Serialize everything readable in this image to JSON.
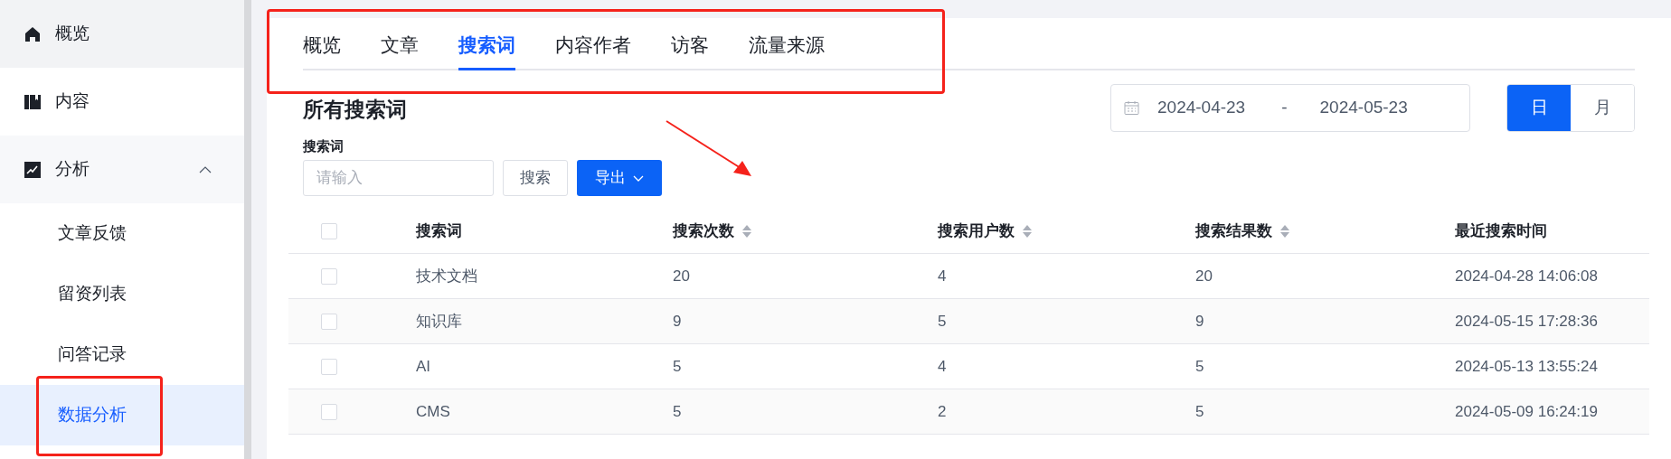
{
  "sidebar": {
    "items": [
      {
        "label": "概览",
        "selected": false
      },
      {
        "label": "内容",
        "selected": false
      },
      {
        "label": "分析",
        "selected": false,
        "expanded": true,
        "children": [
          {
            "label": "文章反馈",
            "selected": false
          },
          {
            "label": "留资列表",
            "selected": false
          },
          {
            "label": "问答记录",
            "selected": false
          },
          {
            "label": "数据分析",
            "selected": true
          }
        ]
      }
    ]
  },
  "tabs": [
    {
      "label": "概览",
      "selected": false
    },
    {
      "label": "文章",
      "selected": false
    },
    {
      "label": "搜索词",
      "selected": true
    },
    {
      "label": "内容作者",
      "selected": false
    },
    {
      "label": "访客",
      "selected": false
    },
    {
      "label": "流量来源",
      "selected": false
    }
  ],
  "title": "所有搜索词",
  "date_range": {
    "start": "2024-04-23",
    "separator": "-",
    "end": "2024-05-23"
  },
  "granularity": [
    {
      "label": "日",
      "selected": true
    },
    {
      "label": "月",
      "selected": false
    }
  ],
  "filter": {
    "label": "搜索词",
    "placeholder": "请输入",
    "search_button": "搜索",
    "export_button": "导出"
  },
  "table": {
    "select_all_checked": false,
    "columns": [
      {
        "label": "搜索词",
        "sortable": false
      },
      {
        "label": "搜索次数",
        "sortable": true
      },
      {
        "label": "搜索用户数",
        "sortable": true
      },
      {
        "label": "搜索结果数",
        "sortable": true
      },
      {
        "label": "最近搜索时间",
        "sortable": false
      }
    ],
    "rows": [
      {
        "checked": false,
        "cells": [
          "技术文档",
          "20",
          "4",
          "20",
          "2024-04-28 14:06:08"
        ]
      },
      {
        "checked": false,
        "cells": [
          "知识库",
          "9",
          "5",
          "9",
          "2024-05-15 17:28:36"
        ]
      },
      {
        "checked": false,
        "cells": [
          "AI",
          "5",
          "4",
          "5",
          "2024-05-13 13:55:24"
        ]
      },
      {
        "checked": false,
        "cells": [
          "CMS",
          "5",
          "2",
          "5",
          "2024-05-09 16:24:19"
        ]
      }
    ]
  }
}
